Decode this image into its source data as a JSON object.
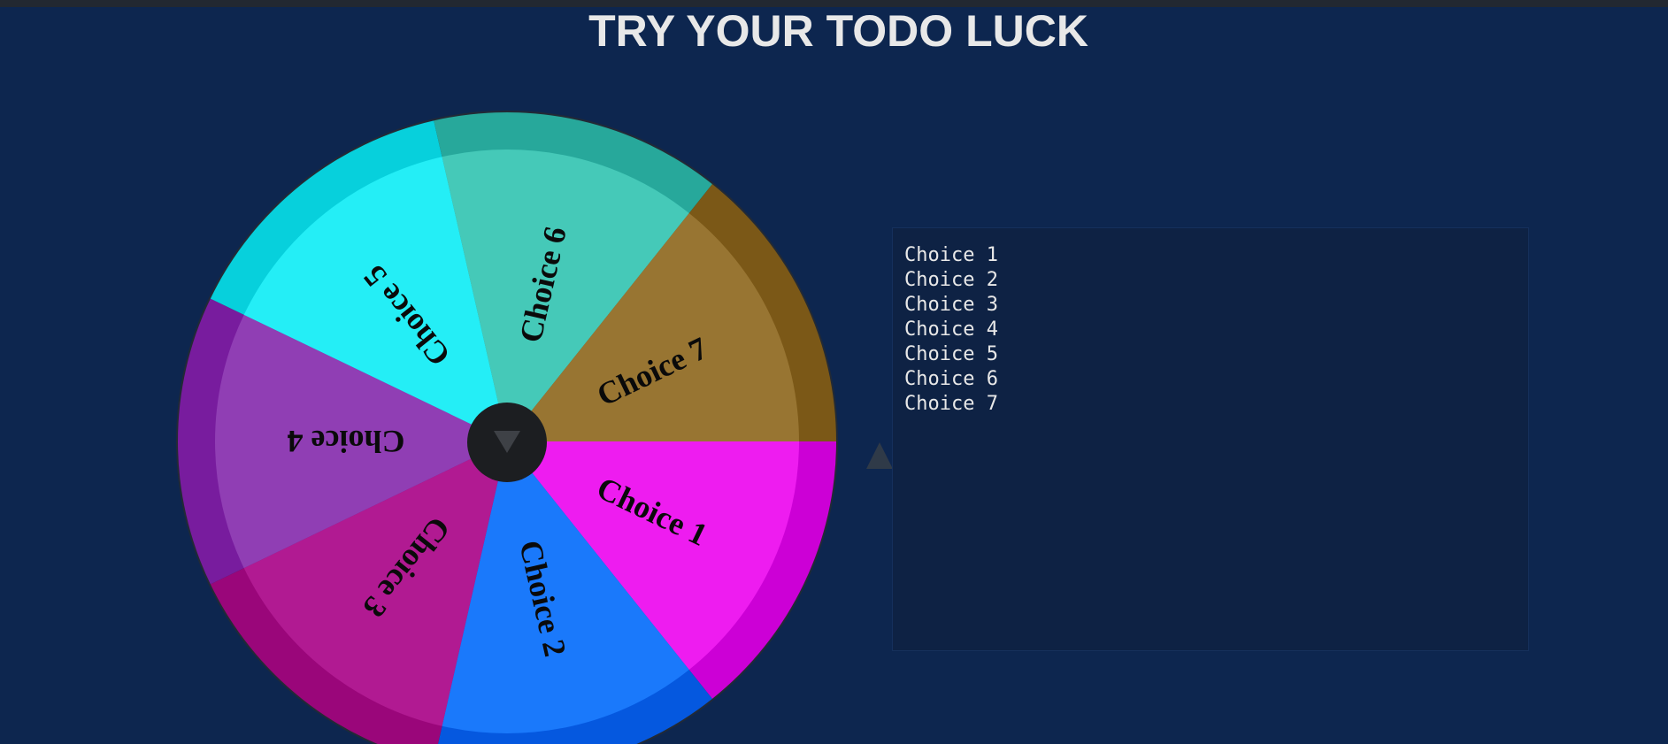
{
  "page": {
    "title": "TRY YOUR TODO LUCK"
  },
  "wheel": {
    "center_button_icon": "play-triangle-down-icon",
    "segments": [
      {
        "label": "Choice 1",
        "color": "#ee1cf0",
        "rim_color": "#cc00d6"
      },
      {
        "label": "Choice 2",
        "color": "#1a79fb",
        "rim_color": "#0558df"
      },
      {
        "label": "Choice 3",
        "color": "#b11a92",
        "rim_color": "#9a067a"
      },
      {
        "label": "Choice 4",
        "color": "#903eb4",
        "rim_color": "#781c9e"
      },
      {
        "label": "Choice 5",
        "color": "#24eef6",
        "rim_color": "#07d0dc"
      },
      {
        "label": "Choice 6",
        "color": "#45c9b8",
        "rim_color": "#27a89b"
      },
      {
        "label": "Choice 7",
        "color": "#987532",
        "rim_color": "#7b5817"
      }
    ]
  },
  "pointer": {
    "icon": "pointer-triangle-icon",
    "color": "#2f3a48"
  },
  "choices_editor": {
    "lines": [
      "Choice 1",
      "Choice 2",
      "Choice 3",
      "Choice 4",
      "Choice 5",
      "Choice 6",
      "Choice 7"
    ]
  }
}
